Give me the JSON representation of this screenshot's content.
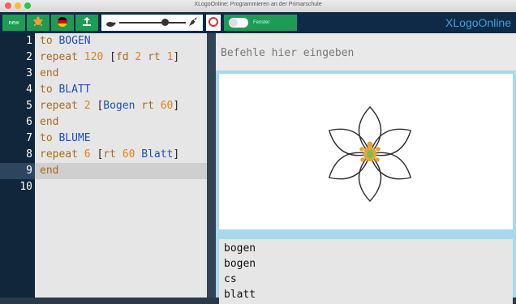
{
  "window": {
    "title": "XLogoOnline: Programmieren an der Primarschule"
  },
  "toolbar": {
    "buttons": [
      {
        "name": "new-button",
        "label": "new"
      },
      {
        "name": "turtle-button",
        "label": ""
      },
      {
        "name": "language-de-button",
        "label": ""
      },
      {
        "name": "upload-button",
        "label": ""
      },
      {
        "name": "stop-button",
        "label": ""
      }
    ],
    "toggle_label": "Fenster",
    "brand": "XLogoOnline"
  },
  "editor": {
    "line_numbers": [
      "1",
      "2",
      "3",
      "4",
      "5",
      "6",
      "7",
      "8",
      "9",
      "10"
    ],
    "lines": [
      [
        {
          "t": "to ",
          "c": "kw"
        },
        {
          "t": "BOGEN",
          "c": "nm"
        }
      ],
      [
        {
          "t": "repeat ",
          "c": "kw"
        },
        {
          "t": "120",
          "c": "num"
        },
        {
          "t": " [",
          "c": "br"
        },
        {
          "t": "fd ",
          "c": "kw"
        },
        {
          "t": "2",
          "c": "num"
        },
        {
          "t": " ",
          "c": "br"
        },
        {
          "t": "rt ",
          "c": "kw"
        },
        {
          "t": "1",
          "c": "num"
        },
        {
          "t": "]",
          "c": "br"
        }
      ],
      [
        {
          "t": "end",
          "c": "kw"
        }
      ],
      [
        {
          "t": "to ",
          "c": "kw"
        },
        {
          "t": "BLATT",
          "c": "nm"
        }
      ],
      [
        {
          "t": "repeat ",
          "c": "kw"
        },
        {
          "t": "2",
          "c": "num"
        },
        {
          "t": " [",
          "c": "br"
        },
        {
          "t": "Bogen ",
          "c": "nm"
        },
        {
          "t": "rt ",
          "c": "kw"
        },
        {
          "t": "60",
          "c": "num"
        },
        {
          "t": "]",
          "c": "br"
        }
      ],
      [
        {
          "t": "end",
          "c": "kw"
        }
      ],
      [
        {
          "t": "to ",
          "c": "kw"
        },
        {
          "t": "BLUME",
          "c": "nm"
        }
      ],
      [
        {
          "t": "repeat ",
          "c": "kw"
        },
        {
          "t": "6",
          "c": "num"
        },
        {
          "t": " [",
          "c": "br"
        },
        {
          "t": "rt ",
          "c": "kw"
        },
        {
          "t": "60",
          "c": "num"
        },
        {
          "t": " ",
          "c": "br"
        },
        {
          "t": "Blatt",
          "c": "nm"
        },
        {
          "t": "]",
          "c": "br"
        }
      ],
      [
        {
          "t": "end",
          "c": "kw"
        }
      ],
      []
    ],
    "active_line": 9
  },
  "command": {
    "placeholder": "Befehle hier eingeben"
  },
  "history": {
    "items": [
      "bogen",
      "bogen",
      "cs",
      "blatt"
    ]
  },
  "colors": {
    "toolbar_bg": "#0e2a47",
    "button_green": "#1e9b55",
    "brand": "#3aa0e0",
    "canvas_border": "#a8d8ec",
    "turtle": "#e8a23a"
  }
}
